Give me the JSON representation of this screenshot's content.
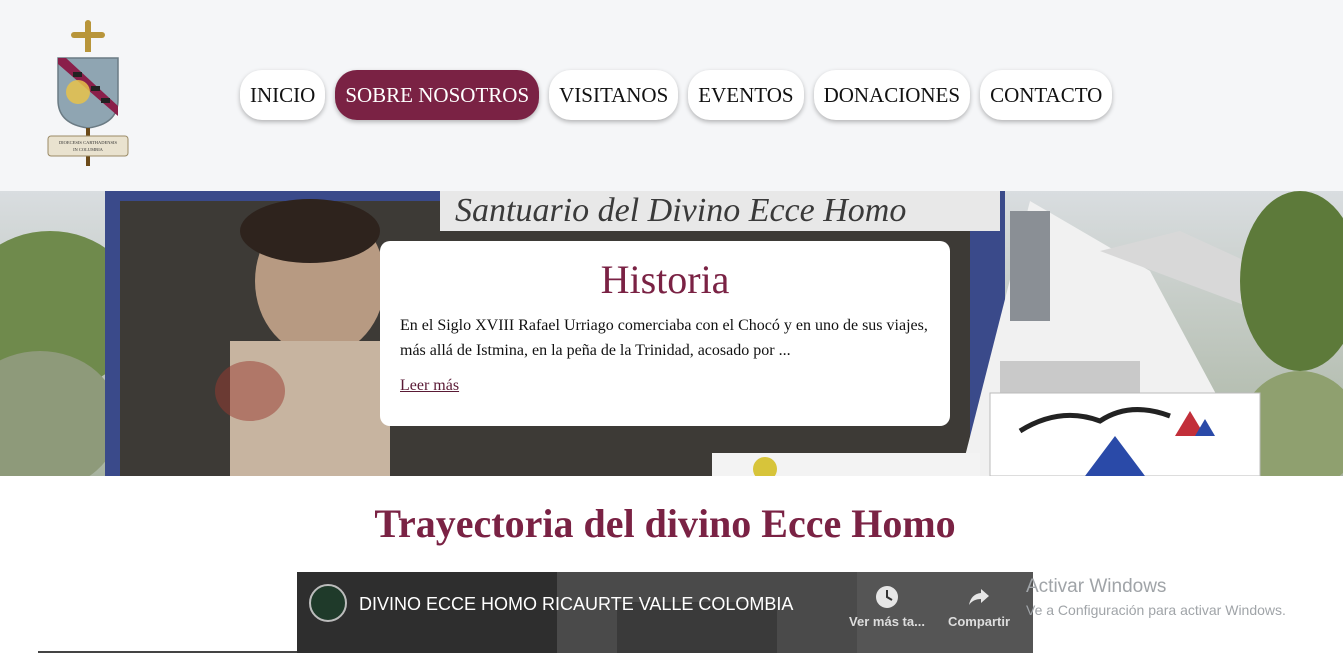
{
  "logo": {
    "scroll_text": "DIOECESIS CARTHADENSIS IN COLUMBIA"
  },
  "nav": {
    "items": [
      {
        "label": "INICIO",
        "active": false
      },
      {
        "label": "SOBRE NOSOTROS",
        "active": true
      },
      {
        "label": "VISITANOS",
        "active": false
      },
      {
        "label": "EVENTOS",
        "active": false
      },
      {
        "label": "DONACIONES",
        "active": false
      },
      {
        "label": "CONTACTO",
        "active": false
      }
    ]
  },
  "hero": {
    "banner_text": "Santuario del Divino Ecce Homo",
    "card": {
      "title": "Historia",
      "text": "En el Siglo XVIII Rafael Urriago comerciaba con el Chocó y en uno de sus viajes, más allá de Istmina, en la peña de la Trinidad, acosado por ...",
      "link": "Leer más"
    }
  },
  "section": {
    "title": "Trayectoria del divino Ecce Homo"
  },
  "video": {
    "title": "DIVINO ECCE HOMO RICAURTE VALLE COLOMBIA",
    "watch_later": "Ver más ta...",
    "share": "Compartir"
  },
  "watermark": {
    "line1": "Activar Windows",
    "line2": "Ve a Configuración para activar Windows."
  },
  "colors": {
    "accent": "#7a2244",
    "header_bg": "#f5f6f8"
  }
}
